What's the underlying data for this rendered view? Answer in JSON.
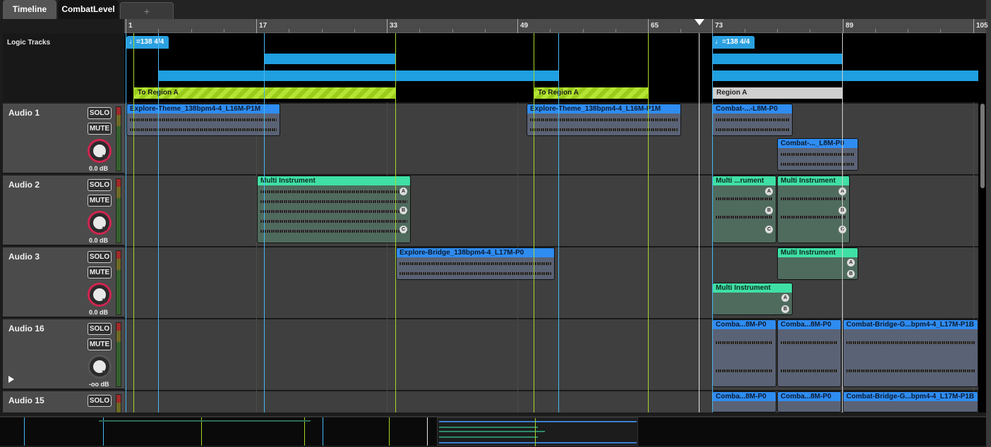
{
  "tabs": [
    {
      "label": "Timeline"
    },
    {
      "label": "CombatLevel"
    },
    {
      "label": "+"
    }
  ],
  "ruler": {
    "bars": [
      "1",
      "17",
      "33",
      "49",
      "65",
      "73",
      "89",
      "105"
    ]
  },
  "logic": {
    "label": "Logic Tracks",
    "tempo_markers": [
      {
        "label": "♩=138 4/4"
      },
      {
        "label": "♩=138 4/4"
      }
    ],
    "regions": [
      {
        "label": "To  Region A"
      },
      {
        "label": "To  Region A"
      },
      {
        "label": "Region A"
      }
    ]
  },
  "tracks": [
    {
      "name": "Audio 1",
      "solo": "SOLO",
      "mute": "MUTE",
      "volume": "0.0 dB"
    },
    {
      "name": "Audio 2",
      "solo": "SOLO",
      "mute": "MUTE",
      "volume": "0.0 dB"
    },
    {
      "name": "Audio 3",
      "solo": "SOLO",
      "mute": "MUTE",
      "volume": "0.0 dB"
    },
    {
      "name": "Audio 16",
      "solo": "SOLO",
      "mute": "MUTE",
      "volume": "-oo dB"
    },
    {
      "name": "Audio 15",
      "solo": "SOLO",
      "mute": "MUTE",
      "volume": ""
    }
  ],
  "clips": [
    {
      "title": "Explore-Theme_138bpm4-4_L16M-P1M"
    },
    {
      "title": "Explore-Theme_138bpm4-4_L16M-P1M"
    },
    {
      "title": "Combat-...-L8M-P0"
    },
    {
      "title": "Combat-..._L8M-P0"
    },
    {
      "title": "Multi Instrument"
    },
    {
      "title": "Multi ...rument"
    },
    {
      "title": "Multi Instrument"
    },
    {
      "title": "Explore-Bridge_138bpm4-4_L17M-P0"
    },
    {
      "title": "Multi Instrument"
    },
    {
      "title": "Multi Instrument"
    },
    {
      "title": "Comba...8M-P0"
    },
    {
      "title": "Comba...8M-P0"
    },
    {
      "title": "Combat-Bridge-G...bpm4-4_L17M-P1B"
    },
    {
      "title": "Comba...8M-P0"
    },
    {
      "title": "Comba...8M-P0"
    },
    {
      "title": "Combat-Bridge-G...bpm4-4_L17M-P1B"
    }
  ],
  "layer_labels": {
    "a": "A",
    "b": "B",
    "c": "C"
  },
  "colors": {
    "accent_blue": "#2f8cf0",
    "multi_green": "#3fe0a6",
    "region_green": "#9acc1c",
    "knob_red": "#d0254f"
  }
}
